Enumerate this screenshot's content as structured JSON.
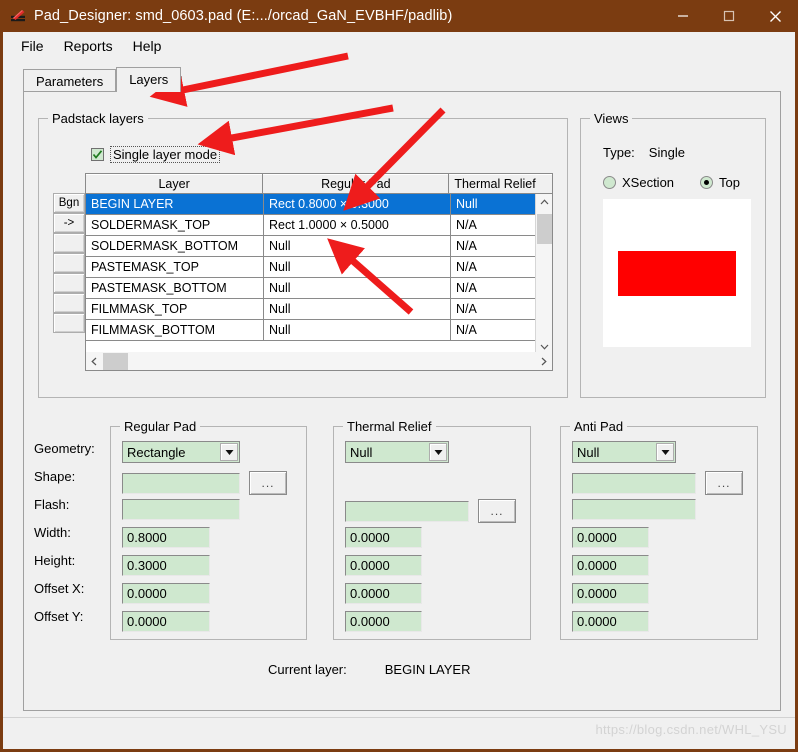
{
  "window": {
    "title": "Pad_Designer: smd_0603.pad (E:.../orcad_GaN_EVBHF/padlib)",
    "icon": "pad-designer-icon",
    "minimize_label": "—",
    "maximize_label": "□",
    "close_label": "✕",
    "titlebar_color": "#7b3c11"
  },
  "menubar": {
    "items": [
      {
        "label": "File"
      },
      {
        "label": "Reports"
      },
      {
        "label": "Help"
      }
    ]
  },
  "tabs": [
    {
      "label": "Parameters",
      "active": false
    },
    {
      "label": "Layers",
      "active": true
    }
  ],
  "padstack": {
    "group_title": "Padstack layers",
    "single_layer_mode": {
      "label": "Single layer mode",
      "checked": true
    },
    "row_buttons": [
      {
        "label": "Bgn"
      },
      {
        "label": "->"
      },
      {
        "label": ""
      },
      {
        "label": ""
      },
      {
        "label": ""
      },
      {
        "label": ""
      },
      {
        "label": ""
      }
    ],
    "columns": [
      "Layer",
      "Regular Pad",
      "Thermal Relief"
    ],
    "rows": [
      {
        "layer": "BEGIN LAYER",
        "regular_pad": "Rect 0.8000 × 0.3000",
        "thermal_relief": "Null",
        "selected": true
      },
      {
        "layer": "SOLDERMASK_TOP",
        "regular_pad": "Rect 1.0000 × 0.5000",
        "thermal_relief": "N/A",
        "selected": false
      },
      {
        "layer": "SOLDERMASK_BOTTOM",
        "regular_pad": "Null",
        "thermal_relief": "N/A",
        "selected": false
      },
      {
        "layer": "PASTEMASK_TOP",
        "regular_pad": "Null",
        "thermal_relief": "N/A",
        "selected": false
      },
      {
        "layer": "PASTEMASK_BOTTOM",
        "regular_pad": "Null",
        "thermal_relief": "N/A",
        "selected": false
      },
      {
        "layer": "FILMMASK_TOP",
        "regular_pad": "Null",
        "thermal_relief": "N/A",
        "selected": false
      },
      {
        "layer": "FILMMASK_BOTTOM",
        "regular_pad": "Null",
        "thermal_relief": "N/A",
        "selected": false
      }
    ],
    "selection_color": "#0a72d4"
  },
  "views": {
    "group_title": "Views",
    "type_label": "Type:",
    "type_value": "Single",
    "radios": [
      {
        "label": "XSection",
        "selected": false
      },
      {
        "label": "Top",
        "selected": true
      }
    ],
    "preview": {
      "background": "#ffffff",
      "pad_color": "#ff0000"
    }
  },
  "field_labels": [
    "Geometry:",
    "Shape:",
    "Flash:",
    "Width:",
    "Height:",
    "Offset X:",
    "Offset Y:"
  ],
  "regular_pad": {
    "group_title": "Regular Pad",
    "geometry": "Rectangle",
    "shape": "",
    "flash": "",
    "width": "0.8000",
    "height": "0.3000",
    "offset_x": "0.0000",
    "offset_y": "0.0000",
    "browse_label": "..."
  },
  "thermal_relief": {
    "group_title": "Thermal Relief",
    "geometry": "Null",
    "shape": "",
    "flash": "",
    "width": "0.0000",
    "height": "0.0000",
    "offset_x": "0.0000",
    "offset_y": "0.0000",
    "browse_label": "..."
  },
  "anti_pad": {
    "group_title": "Anti Pad",
    "geometry": "Null",
    "shape": "",
    "flash": "",
    "width": "0.0000",
    "height": "0.0000",
    "offset_x": "0.0000",
    "offset_y": "0.0000",
    "browse_label": "..."
  },
  "status": {
    "current_layer_label": "Current layer:",
    "current_layer_value": "BEGIN LAYER",
    "watermark": "https://blog.csdn.net/WHL_YSU"
  },
  "annotations": {
    "arrow_color": "#ee1c1c",
    "count": 4
  }
}
